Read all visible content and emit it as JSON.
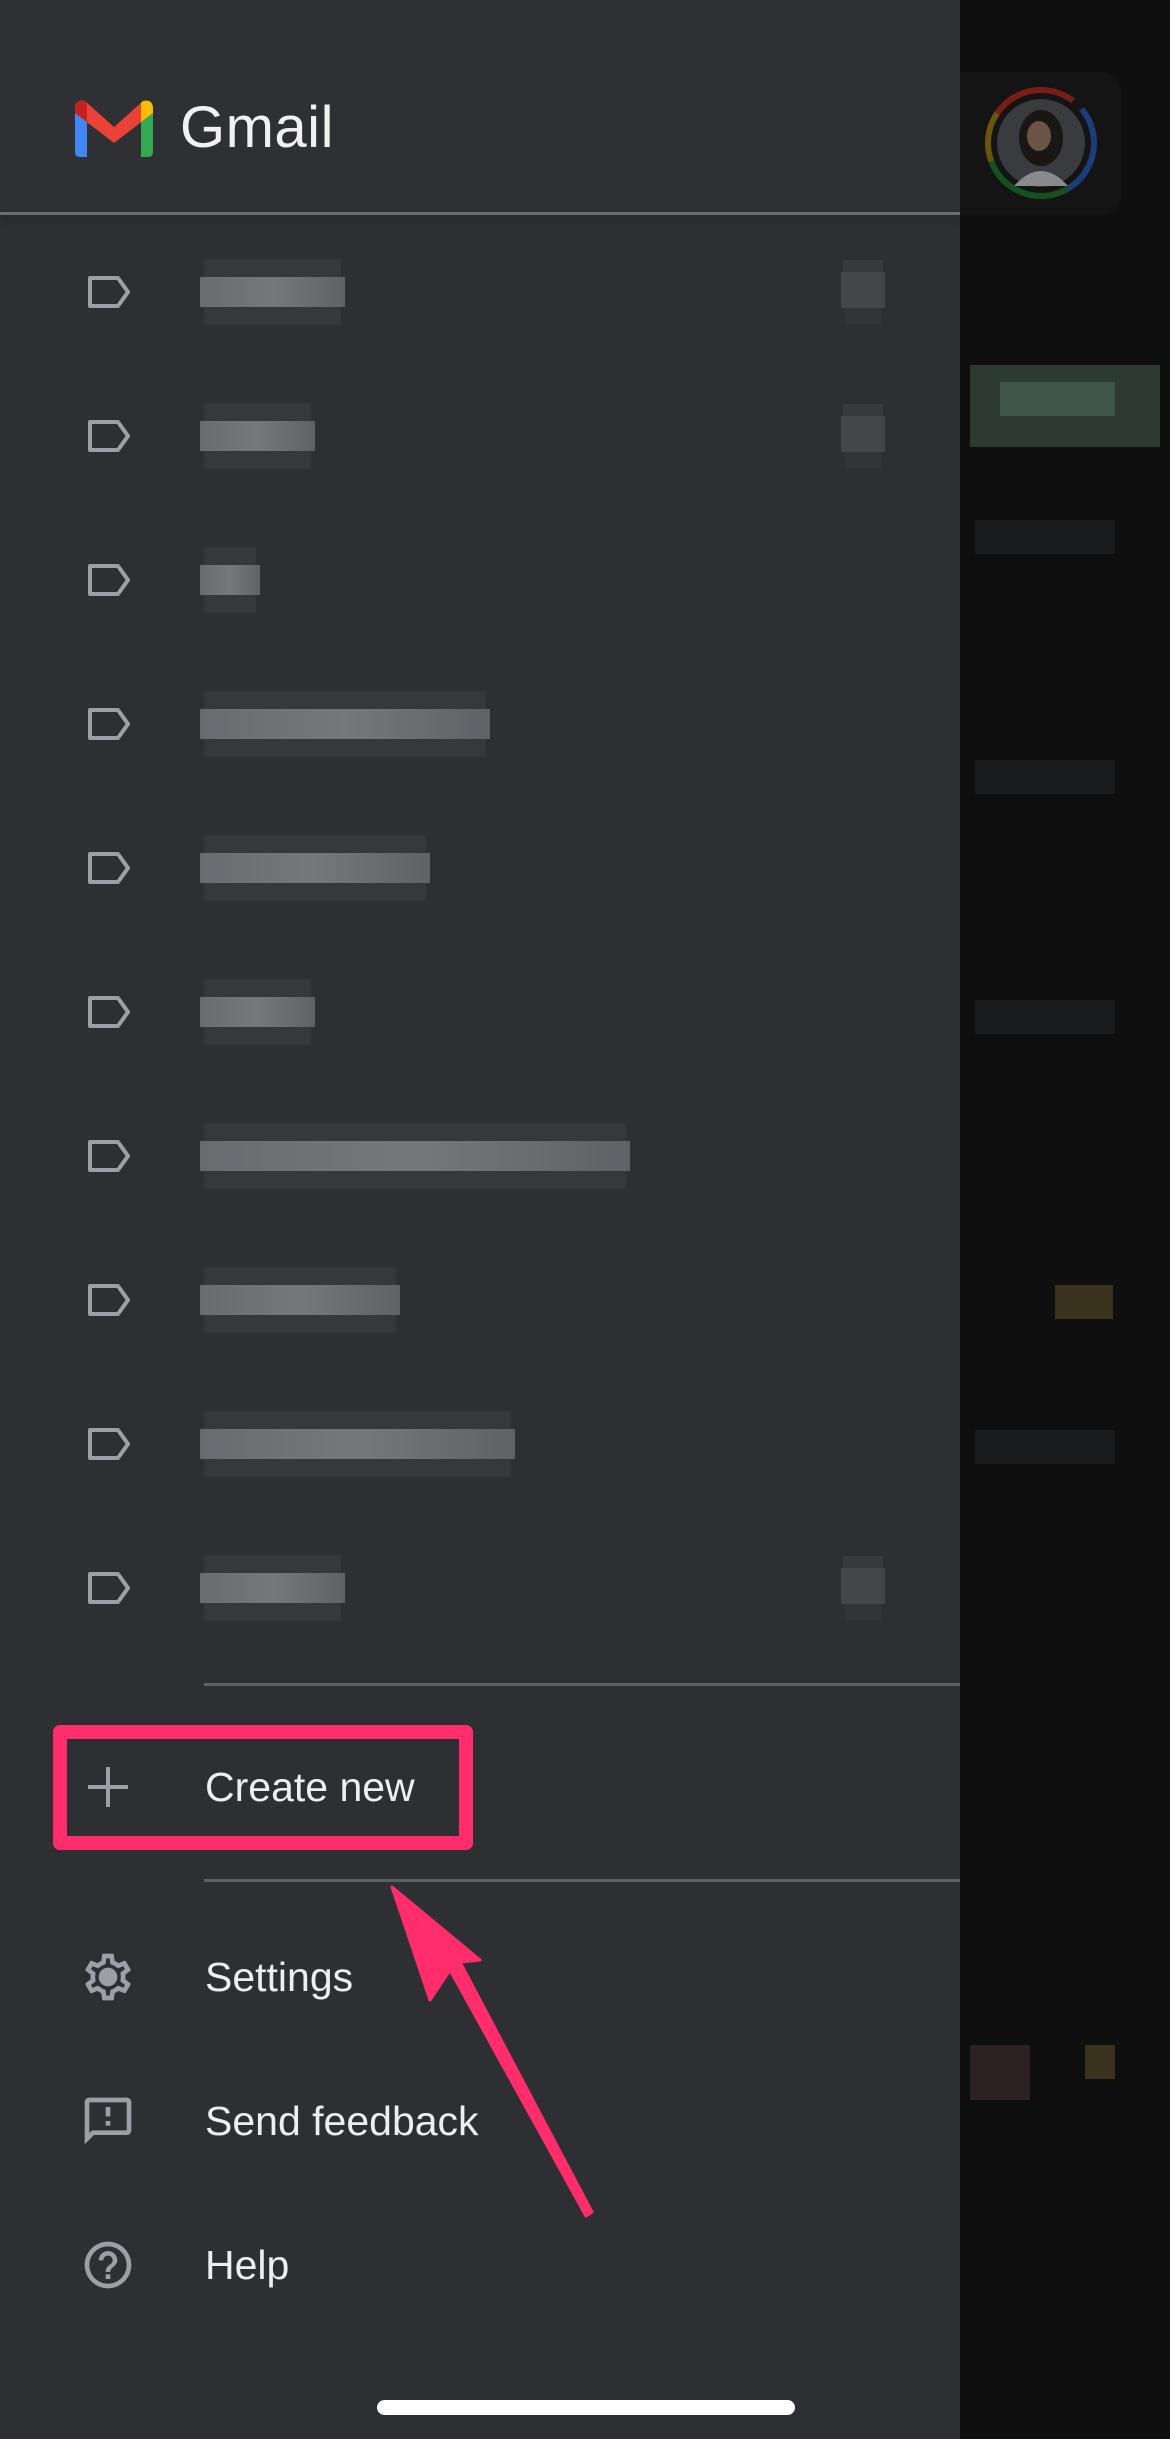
{
  "app": {
    "title": "Gmail",
    "brand_colors": {
      "red": "#ea4335",
      "blue": "#4285f4",
      "green": "#34a853",
      "yellow": "#fbbc04",
      "dark_red": "#c5221f"
    }
  },
  "header": {
    "logo_icon": "gmail-logo-icon",
    "title": "Gmail",
    "account_avatar": "profile-avatar"
  },
  "labels": {
    "icon": "label-icon",
    "items": [
      {
        "name": "[redacted]",
        "redacted": true,
        "has_count": true
      },
      {
        "name": "[redacted]",
        "redacted": true,
        "has_count": true
      },
      {
        "name": "[redacted]",
        "redacted": true,
        "has_count": false
      },
      {
        "name": "[redacted]",
        "redacted": true,
        "has_count": false
      },
      {
        "name": "[redacted]",
        "redacted": true,
        "has_count": false
      },
      {
        "name": "[redacted]",
        "redacted": true,
        "has_count": false
      },
      {
        "name": "[redacted]",
        "redacted": true,
        "has_count": false
      },
      {
        "name": "[redacted]",
        "redacted": true,
        "has_count": false
      },
      {
        "name": "[redacted]",
        "redacted": true,
        "has_count": false
      },
      {
        "name": "[redacted]",
        "redacted": true,
        "has_count": true
      }
    ]
  },
  "create_new": {
    "icon": "plus-icon",
    "label": "Create new"
  },
  "footer_menu": [
    {
      "icon": "gear-icon",
      "label": "Settings"
    },
    {
      "icon": "feedback-icon",
      "label": "Send feedback"
    },
    {
      "icon": "help-icon",
      "label": "Help"
    }
  ],
  "annotation": {
    "highlight_color": "#ff2d6b",
    "target": "Create new"
  }
}
